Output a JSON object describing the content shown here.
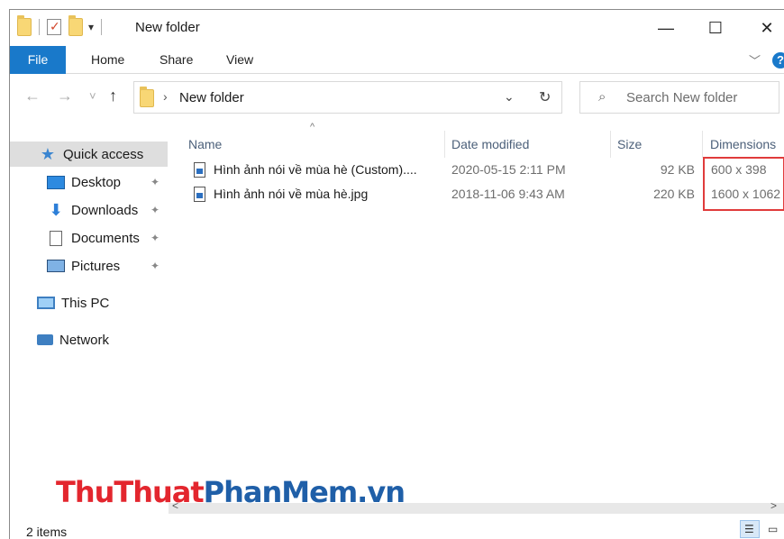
{
  "window": {
    "title": "New folder"
  },
  "title_controls": {
    "minimize": "—",
    "maximize": "☐",
    "close": "✕"
  },
  "ribbon": {
    "tabs": [
      "File",
      "Home",
      "Share",
      "View"
    ],
    "collapse_glyph": "﹀",
    "help_glyph": "?"
  },
  "address": {
    "back_glyph": "←",
    "forward_glyph": "→",
    "recent_glyph": "˅",
    "up_glyph": "↑",
    "path": "New folder",
    "separator": "›",
    "dropdown_glyph": "⌄",
    "refresh_glyph": "↻"
  },
  "search": {
    "placeholder": "Search New folder",
    "icon": "search-icon"
  },
  "nav": {
    "items": [
      {
        "label": "Quick access",
        "icon": "star-icon"
      },
      {
        "label": "Desktop",
        "icon": "desktop-icon",
        "pinned": true
      },
      {
        "label": "Downloads",
        "icon": "downloads-icon",
        "pinned": true
      },
      {
        "label": "Documents",
        "icon": "documents-icon",
        "pinned": true
      },
      {
        "label": "Pictures",
        "icon": "pictures-icon",
        "pinned": true
      },
      {
        "label": "This PC",
        "icon": "pc-icon"
      },
      {
        "label": "Network",
        "icon": "network-icon"
      }
    ],
    "pin_glyph": "📌"
  },
  "columns": {
    "name": "Name",
    "date": "Date modified",
    "size": "Size",
    "dimensions": "Dimensions",
    "sort_glyph": "^"
  },
  "files": [
    {
      "name": "Hình ảnh nói về mùa hè (Custom)....",
      "date": "2020-05-15 2:11 PM",
      "size": "92 KB",
      "dimensions": "600 x 398"
    },
    {
      "name": "Hình ảnh nói về mùa hè.jpg",
      "date": "2018-11-06 9:43 AM",
      "size": "220 KB",
      "dimensions": "1600 x 1062"
    }
  ],
  "status": {
    "items": "2 items"
  },
  "scroll": {
    "left_glyph": "<",
    "right_glyph": ">"
  },
  "watermark": {
    "part1": "ThuThuat",
    "part2": "PhanMem.vn"
  },
  "colors": {
    "accent": "#1979ca",
    "highlight_box": "#e03b3b",
    "watermark_red": "#e3262e",
    "watermark_blue": "#1f5fa8"
  }
}
